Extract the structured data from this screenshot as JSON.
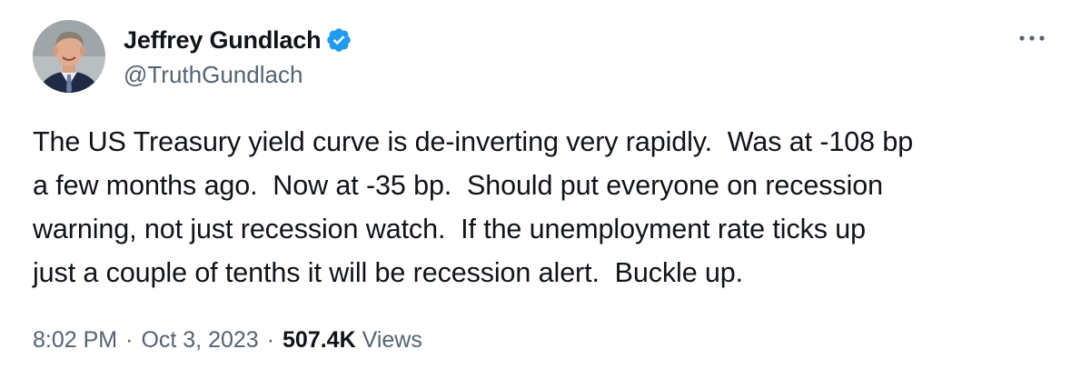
{
  "author": {
    "display_name": "Jeffrey Gundlach",
    "handle": "@TruthGundlach",
    "verified_icon": "verified-badge-icon",
    "verified_color": "#1d9bf0"
  },
  "more_icon": "more-horizontal-icon",
  "tweet": {
    "text": "The US Treasury yield curve is de-inverting very rapidly.  Was at -108 bp\na few months ago.  Now at -35 bp.  Should put everyone on recession\nwarning, not just recession watch.  If the unemployment rate ticks up\njust a couple of tenths it will be recession alert.  Buckle up."
  },
  "meta": {
    "time": "8:02 PM",
    "separator": "·",
    "date": "Oct 3, 2023",
    "views_count": "507.4K",
    "views_label": "Views"
  },
  "colors": {
    "text_primary": "#0f1419",
    "text_secondary": "#536471"
  }
}
